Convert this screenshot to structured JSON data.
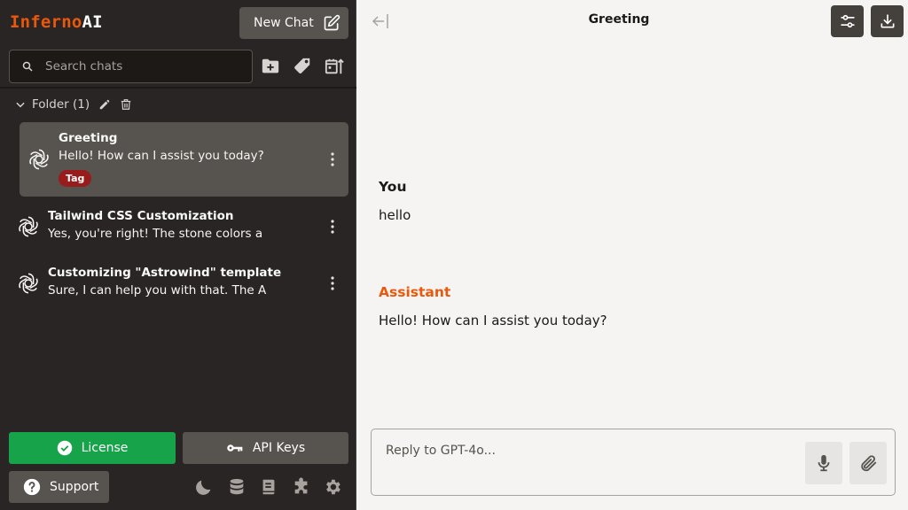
{
  "app": {
    "logo_part1": "Inferno",
    "logo_part2": "AI"
  },
  "sidebar": {
    "new_chat_label": "New Chat",
    "search_placeholder": "Search chats",
    "folder": {
      "label": "Folder (1)"
    },
    "chats": [
      {
        "title": "Greeting",
        "preview": "Hello! How can I assist you today?",
        "tag": "Tag",
        "selected": true
      },
      {
        "title": "Tailwind CSS Customization",
        "preview": "Yes, you're right! The stone colors a"
      },
      {
        "title": "Customizing \"Astrowind\" template",
        "preview": "Sure, I can help you with that. The A"
      }
    ],
    "license_label": "License",
    "api_keys_label": "API Keys",
    "support_label": "Support"
  },
  "main": {
    "title": "Greeting",
    "messages": [
      {
        "role": "You",
        "text": "hello"
      },
      {
        "role": "Assistant",
        "text": "Hello! How can I assist you today?"
      }
    ],
    "reply_placeholder": "Reply to GPT-4o..."
  },
  "colors": {
    "accent": "#ea580c",
    "sidebar_bg": "#292524",
    "license_green": "#16a34a",
    "tag_red": "#991b1b"
  }
}
